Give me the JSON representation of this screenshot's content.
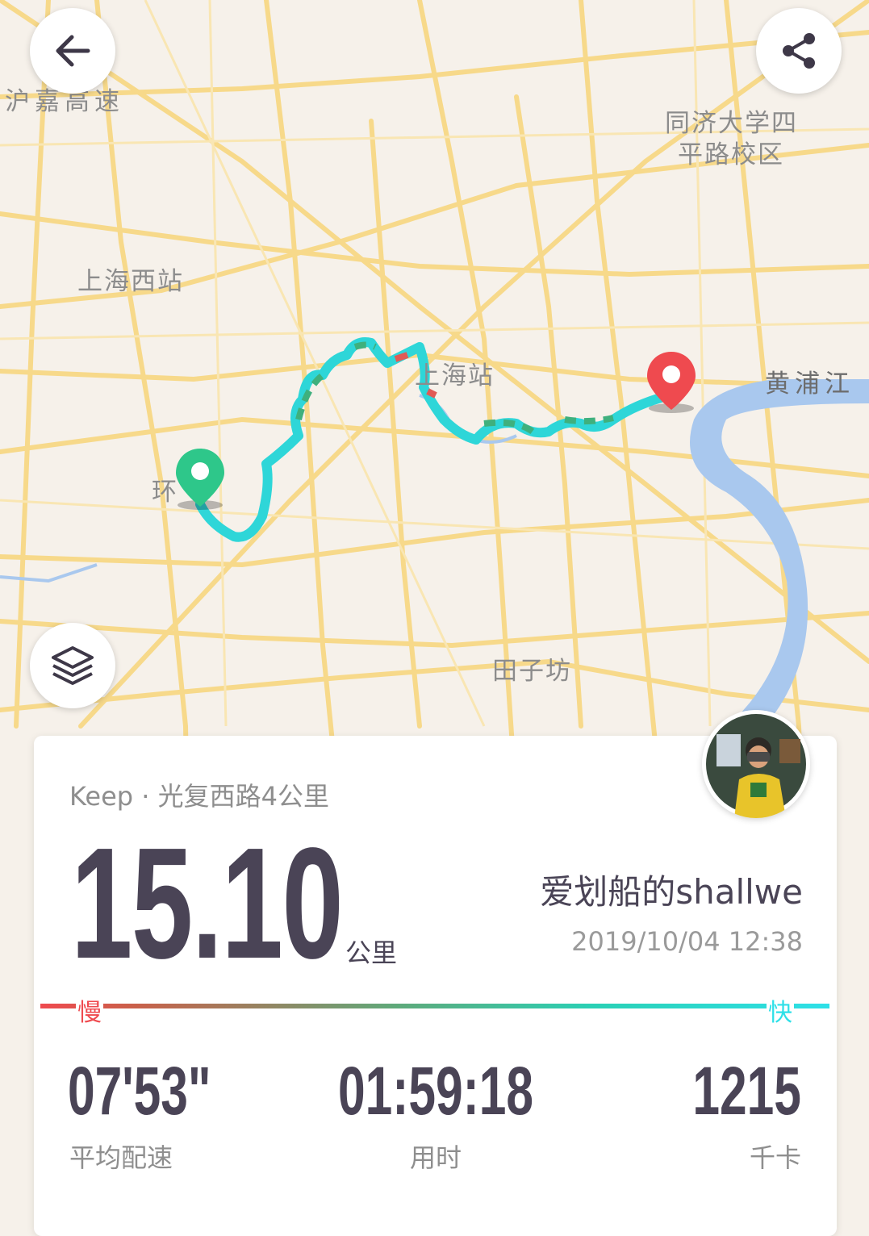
{
  "map": {
    "labels": [
      "沪嘉高速",
      "同济大学四",
      "平路校区",
      "上海西站",
      "上海站",
      "黄浦江",
      "田子坊",
      "环"
    ],
    "start_marker": "start-pin-icon",
    "end_marker": "end-pin-icon"
  },
  "header": {
    "back_icon": "arrow-left-icon",
    "share_icon": "share-icon"
  },
  "layers_icon": "layers-icon",
  "summary": {
    "source": "Keep · 光复西路4公里",
    "distance": "15.10",
    "distance_unit": "公里",
    "username": "爱划船的shallwe",
    "datetime": "2019/10/04 12:38",
    "pace_slow_label": "慢",
    "pace_fast_label": "快",
    "stats": [
      {
        "value": "07'53\"",
        "label": "平均配速"
      },
      {
        "value": "01:59:18",
        "label": "用时"
      },
      {
        "value": "1215",
        "label": "千卡"
      }
    ]
  },
  "colors": {
    "route": "#2ed6d8",
    "start_pin": "#2ec78a",
    "end_pin": "#ef4a4f",
    "river": "#a9c8ee",
    "road": "#f7d98a",
    "text_dark": "#4a4456"
  }
}
